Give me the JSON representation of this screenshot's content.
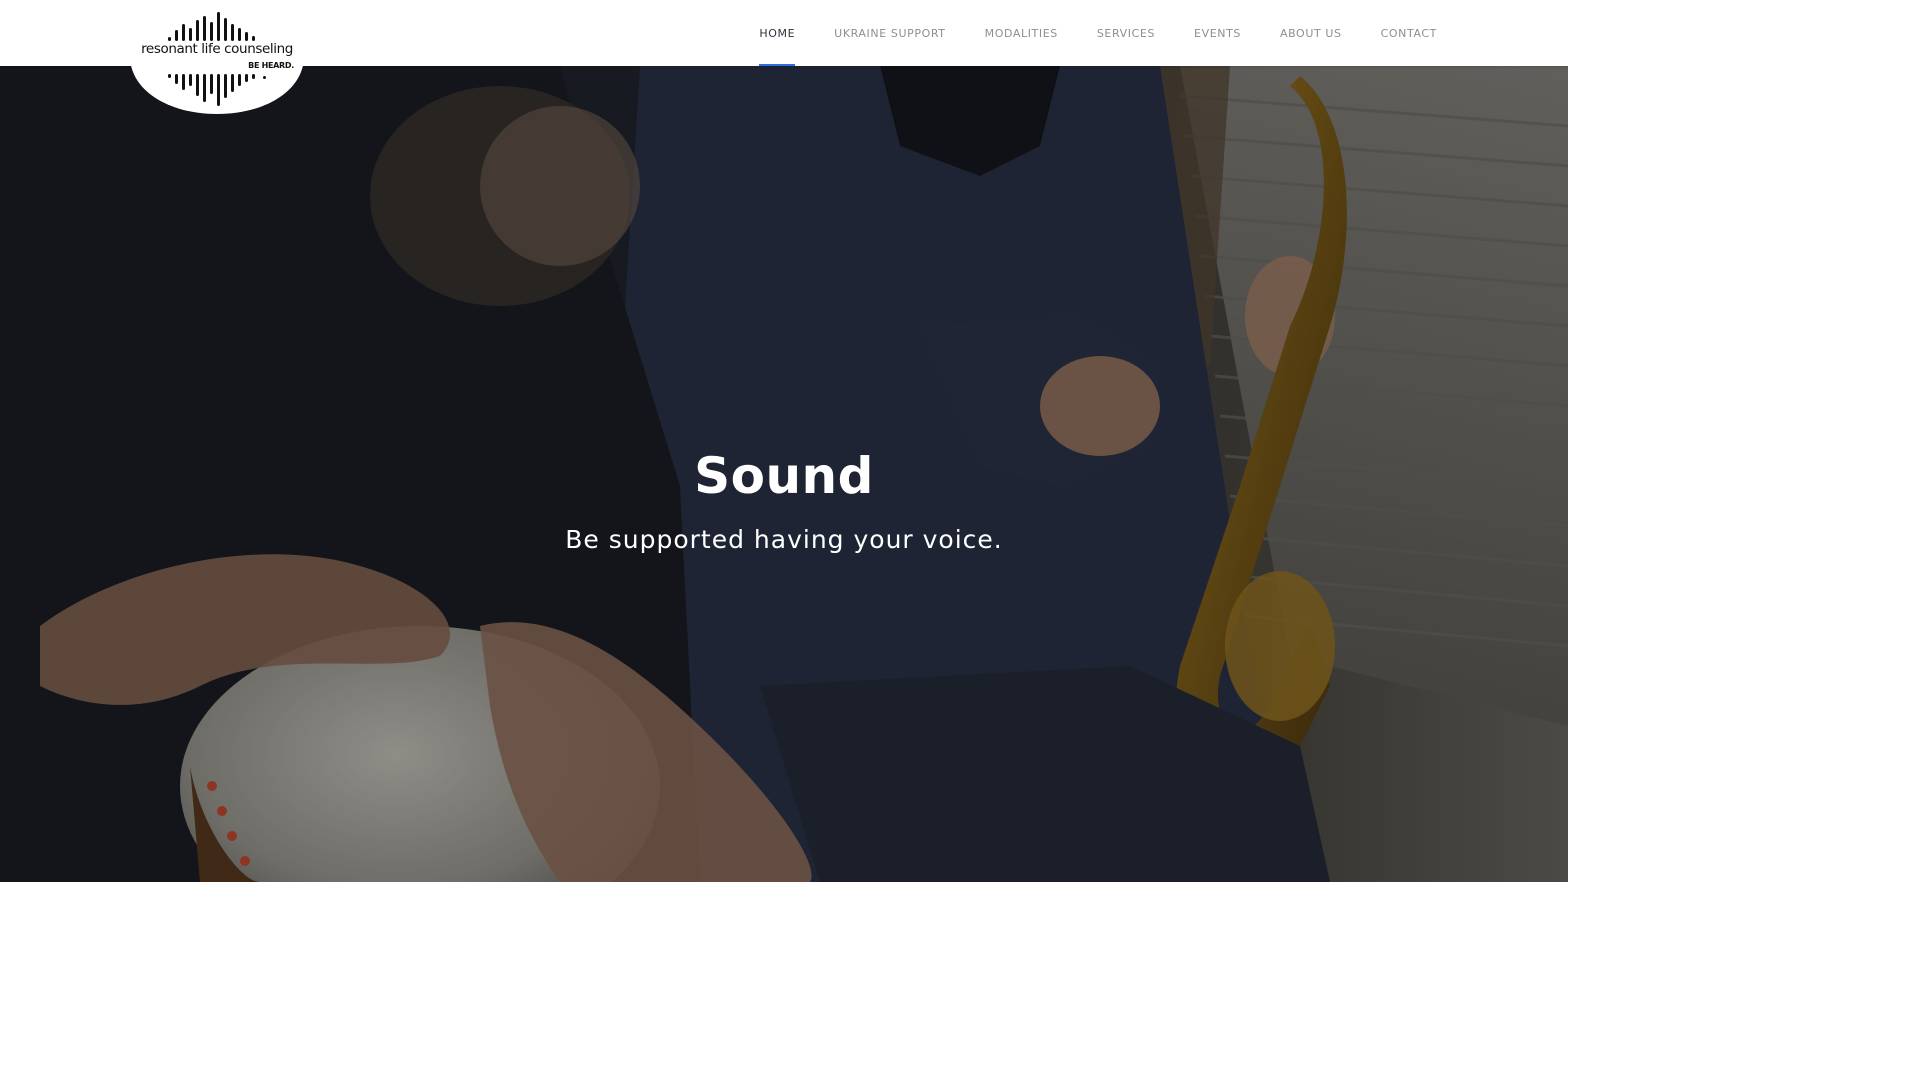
{
  "brand": {
    "name": "resonant life counseling",
    "tagline": "BE HEARD."
  },
  "nav": {
    "items": [
      {
        "label": "HOME",
        "active": true
      },
      {
        "label": "UKRAINE SUPPORT",
        "active": false
      },
      {
        "label": "MODALITIES",
        "active": false
      },
      {
        "label": "SERVICES",
        "active": false
      },
      {
        "label": "EVENTS",
        "active": false
      },
      {
        "label": "ABOUT US",
        "active": false
      },
      {
        "label": "CONTACT",
        "active": false
      }
    ],
    "active_color": "#2f6fe0"
  },
  "hero": {
    "title": "Sound",
    "subtitle": "Be supported having your voice."
  }
}
